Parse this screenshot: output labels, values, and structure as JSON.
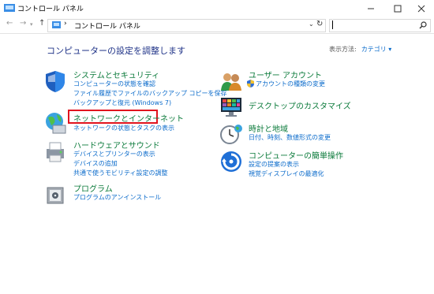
{
  "window": {
    "title": "コントロール パネル"
  },
  "address": {
    "path": "コントロール パネル",
    "search_placeholder": ""
  },
  "page": {
    "heading": "コンピューターの設定を調整します",
    "view_by_label": "表示方法:",
    "view_by_value": "カテゴリ ▾"
  },
  "categories": {
    "system": {
      "title": "システムとセキュリティ",
      "links": [
        "コンピューターの状態を確認",
        "ファイル履歴でファイルのバックアップ コピーを保存",
        "バックアップと復元 (Windows 7)"
      ]
    },
    "network": {
      "title": "ネットワークとインターネット",
      "links": [
        "ネットワークの状態とタスクの表示"
      ]
    },
    "hardware": {
      "title": "ハードウェアとサウンド",
      "links": [
        "デバイスとプリンターの表示",
        "デバイスの追加",
        "共通で使うモビリティ設定の調整"
      ]
    },
    "programs": {
      "title": "プログラム",
      "links": [
        "プログラムのアンインストール"
      ]
    },
    "user": {
      "title": "ユーザー アカウント",
      "links": [
        "アカウントの種類の変更"
      ]
    },
    "desktop": {
      "title": "デスクトップのカスタマイズ",
      "links": []
    },
    "clock": {
      "title": "時計と地域",
      "links": [
        "日付、時刻、数値形式の変更"
      ]
    },
    "access": {
      "title": "コンピューターの簡単操作",
      "links": [
        "設定の提案の表示",
        "視覚ディスプレイの最適化"
      ]
    }
  },
  "colors": {
    "highlight": "#e1141e",
    "link": "#0b6bcb",
    "category": "#0a7a3a"
  }
}
